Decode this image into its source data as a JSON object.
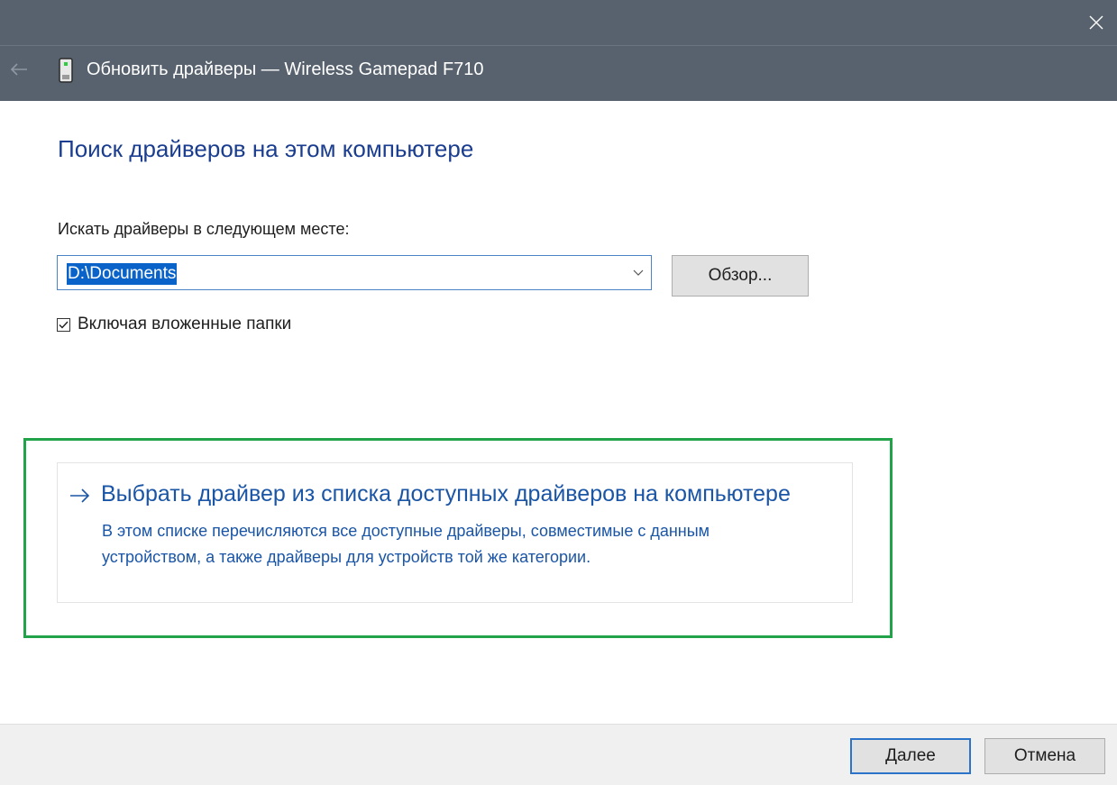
{
  "window": {
    "title": "Обновить драйверы — Wireless Gamepad F710",
    "close_icon": "close-icon",
    "back_icon": "back-arrow-icon",
    "device_icon": "gamepad-device-icon"
  },
  "main": {
    "heading": "Поиск драйверов на этом компьютере",
    "path_label": "Искать драйверы в следующем месте:",
    "path_value": "D:\\Documents",
    "browse_label": "Обзор...",
    "include_subfolders_label": "Включая вложенные папки",
    "include_subfolders_checked": true
  },
  "option": {
    "title": "Выбрать драйвер из списка доступных драйверов на компьютере",
    "description_line1": "В этом списке перечисляются все доступные драйверы, совместимые с данным",
    "description_line2": "устройством, а также драйверы для устройств той же категории."
  },
  "footer": {
    "next_label": "Далее",
    "cancel_label": "Отмена"
  },
  "colors": {
    "titlebar": "#58626e",
    "heading": "#1a3d8f",
    "link": "#1a55a6",
    "highlight": "#22a34a",
    "selection": "#0a63c9"
  }
}
